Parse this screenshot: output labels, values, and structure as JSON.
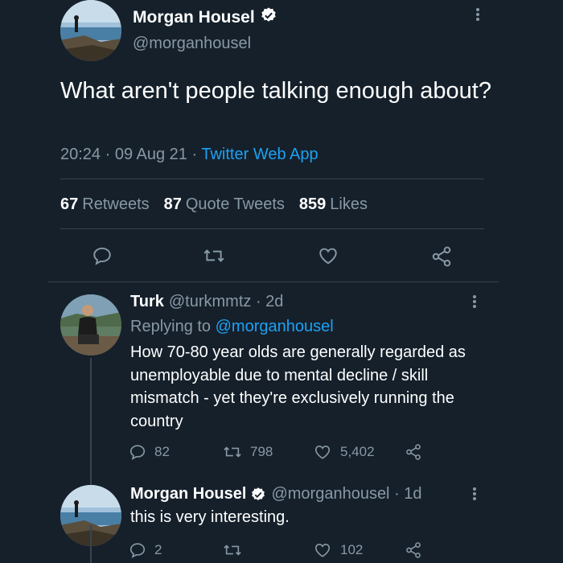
{
  "main_tweet": {
    "author_name": "Morgan Housel",
    "author_handle": "@morganhousel",
    "text": "What aren't people talking enough about?",
    "time": "20:24",
    "date": "09 Aug 21",
    "source": "Twitter Web App",
    "stats": {
      "retweets_count": "67",
      "retweets_label": "Retweets",
      "quote_count": "87",
      "quote_label": "Quote Tweets",
      "likes_count": "859",
      "likes_label": "Likes"
    }
  },
  "reply": {
    "author_name": "Turk",
    "author_handle": "@turkmmtz",
    "age": "2d",
    "replying_prefix": "Replying to",
    "replying_to": "@morganhousel",
    "text": "How 70-80 year olds are generally regarded as unemployable due to mental decline / skill mismatch - yet they're exclusively running the country",
    "replies": "82",
    "retweets": "798",
    "likes": "5,402"
  },
  "reply2": {
    "author_name": "Morgan Housel",
    "author_handle": "@morganhousel",
    "age": "1d",
    "text": "this is very interesting.",
    "replies": "2",
    "retweets": "",
    "likes": "102"
  },
  "colors": {
    "background": "#15202b",
    "secondary_text": "#8899a6",
    "link": "#1da1f2",
    "divider": "#38444d"
  },
  "icons": [
    "verified-badge-icon",
    "more-options-icon",
    "reply-icon",
    "retweet-icon",
    "like-icon",
    "share-icon"
  ]
}
